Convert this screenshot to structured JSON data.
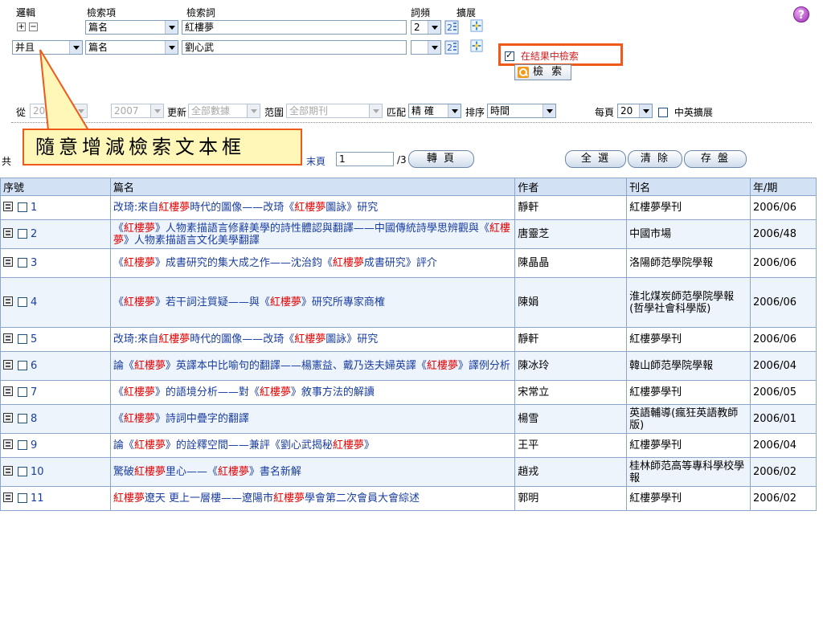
{
  "form": {
    "col_logic": "邏輯",
    "col_field": "檢索項",
    "col_term": "檢索詞",
    "col_freq": "詞頻",
    "col_ext": "擴展",
    "plus": "⊞",
    "minus": "⊟",
    "row1_field": "篇名",
    "row1_term": "紅樓夢",
    "row1_freq": "2",
    "row2_logic": "并且",
    "row2_field": "篇名",
    "row2_term": "劉心武",
    "row2_freq": "",
    "in_results_label": "在結果中檢索",
    "in_results_checked": true,
    "search_button": "檢 索",
    "from_label": "從",
    "from_value": "2000",
    "to_value": "2007",
    "update_label": "更新",
    "update_value": "全部數據",
    "scope_label": "范圍",
    "scope_value": "全部期刊",
    "match_label": "匹配",
    "match_value": "精 確",
    "sort_label": "排序",
    "sort_value": "時間",
    "per_page_label": "每頁",
    "per_page_value": "20",
    "cn_en_label": "中英擴展",
    "help": "?"
  },
  "callout": "隨意增減檢索文本框",
  "pager": {
    "total_prefix": "共",
    "last_page": "末頁",
    "page_input": "1",
    "page_total": "/3",
    "goto": "轉 頁",
    "select_all": "全 選",
    "clear": "清 除",
    "save": "存 盤"
  },
  "table": {
    "headers": [
      "序號",
      "篇名",
      "作者",
      "刊名",
      "年/期"
    ],
    "rows": [
      {
        "num": "1",
        "title": [
          [
            "改琦:來自",
            0
          ],
          [
            "紅樓夢",
            1
          ],
          [
            "時代的圖像——改琦《",
            0
          ],
          [
            "紅樓夢",
            1
          ],
          [
            "圖詠》研究",
            0
          ]
        ],
        "author": "靜軒",
        "journal": "紅樓夢學刊",
        "issue": "2006/06"
      },
      {
        "num": "2",
        "title": [
          [
            "《",
            0
          ],
          [
            "紅樓夢",
            1
          ],
          [
            "》人物素描語言修辭美學的詩性體認與翻譯——中國傳統詩學思辨觀與《",
            0
          ],
          [
            "紅樓夢",
            1
          ],
          [
            "》人物素描語言文化美學翻譯",
            0
          ]
        ],
        "author": "唐靈芝",
        "journal": "中國市場",
        "issue": "2006/48"
      },
      {
        "num": "3",
        "title": [
          [
            "《",
            0
          ],
          [
            "紅樓夢",
            1
          ],
          [
            "》成書研究的集大成之作——沈治鈞《",
            0
          ],
          [
            "紅樓夢",
            1
          ],
          [
            "成書研究》評介",
            0
          ]
        ],
        "author": "陳晶晶",
        "journal": "洛陽師范學院學報",
        "issue": "2006/06"
      },
      {
        "num": "4",
        "title": [
          [
            "《",
            0
          ],
          [
            "紅樓夢",
            1
          ],
          [
            "》若干詞注質疑——與《",
            0
          ],
          [
            "紅樓夢",
            1
          ],
          [
            "》研究所專家商榷",
            0
          ]
        ],
        "author": "陳娟",
        "journal": "淮北煤炭師范學院學報(哲學社會科學版)",
        "issue": "2006/06"
      },
      {
        "num": "5",
        "title": [
          [
            "改琦:來自",
            0
          ],
          [
            "紅樓夢",
            1
          ],
          [
            "時代的圖像——改琦《",
            0
          ],
          [
            "紅樓夢",
            1
          ],
          [
            "圖詠》研究",
            0
          ]
        ],
        "author": "靜軒",
        "journal": "紅樓夢學刊",
        "issue": "2006/06"
      },
      {
        "num": "6",
        "title": [
          [
            "論《",
            0
          ],
          [
            "紅樓夢",
            1
          ],
          [
            "》英譯本中比喻句的翻譯——楊憲益、戴乃迭夫婦英譯《",
            0
          ],
          [
            "紅樓夢",
            1
          ],
          [
            "》譯例分析",
            0
          ]
        ],
        "author": "陳冰玲",
        "journal": "韓山師范學院學報",
        "issue": "2006/04"
      },
      {
        "num": "7",
        "title": [
          [
            "《",
            0
          ],
          [
            "紅樓夢",
            1
          ],
          [
            "》的語境分析——對《",
            0
          ],
          [
            "紅樓夢",
            1
          ],
          [
            "》敘事方法的解讀",
            0
          ]
        ],
        "author": "宋常立",
        "journal": "紅樓夢學刊",
        "issue": "2006/05"
      },
      {
        "num": "8",
        "title": [
          [
            "《",
            0
          ],
          [
            "紅樓夢",
            1
          ],
          [
            "》詩詞中疊字的翻譯",
            0
          ]
        ],
        "author": "楊雪",
        "journal": "英語輔導(瘋狂英語教師版)",
        "issue": "2006/01"
      },
      {
        "num": "9",
        "title": [
          [
            "論《",
            0
          ],
          [
            "紅樓夢",
            1
          ],
          [
            "》的詮釋空間——兼評《劉心武揭秘",
            0
          ],
          [
            "紅樓夢",
            1
          ],
          [
            "》",
            0
          ]
        ],
        "author": "王平",
        "journal": "紅樓夢學刊",
        "issue": "2006/04"
      },
      {
        "num": "10",
        "title": [
          [
            "驚破",
            0
          ],
          [
            "紅樓夢",
            1
          ],
          [
            "里心——《",
            0
          ],
          [
            "紅樓夢",
            1
          ],
          [
            "》書名新解",
            0
          ]
        ],
        "author": "趙戎",
        "journal": "桂林師范高等專科學校學報",
        "issue": "2006/02"
      },
      {
        "num": "11",
        "title": [
          [
            "紅樓夢",
            1
          ],
          [
            "遼天 更上一層樓——遼陽市",
            0
          ],
          [
            "紅樓夢",
            1
          ],
          [
            "學會第二次會員大會綜述",
            0
          ]
        ],
        "author": "郭明",
        "journal": "紅樓夢學刊",
        "issue": "2006/02"
      }
    ]
  }
}
